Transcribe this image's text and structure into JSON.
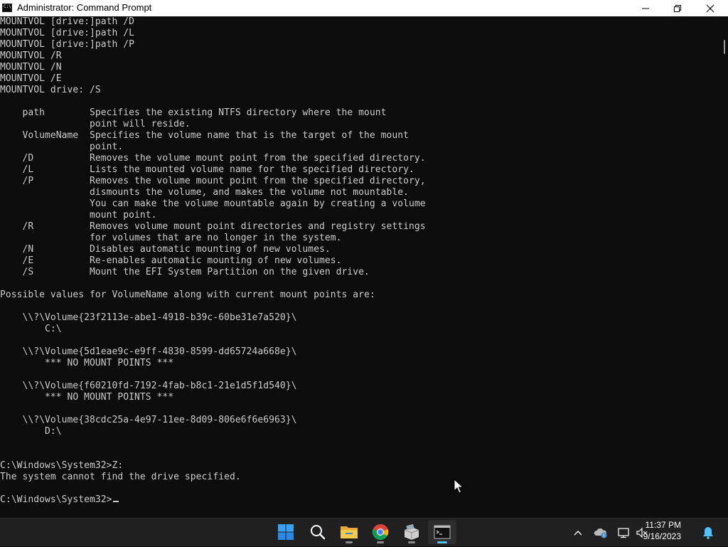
{
  "window": {
    "title": "Administrator: Command Prompt",
    "icon_text": "C:\\"
  },
  "console": {
    "lines": [
      "MOUNTVOL [drive:]path /D",
      "MOUNTVOL [drive:]path /L",
      "MOUNTVOL [drive:]path /P",
      "MOUNTVOL /R",
      "MOUNTVOL /N",
      "MOUNTVOL /E",
      "MOUNTVOL drive: /S",
      "",
      "    path        Specifies the existing NTFS directory where the mount",
      "                point will reside.",
      "    VolumeName  Specifies the volume name that is the target of the mount",
      "                point.",
      "    /D          Removes the volume mount point from the specified directory.",
      "    /L          Lists the mounted volume name for the specified directory.",
      "    /P          Removes the volume mount point from the specified directory,",
      "                dismounts the volume, and makes the volume not mountable.",
      "                You can make the volume mountable again by creating a volume",
      "                mount point.",
      "    /R          Removes volume mount point directories and registry settings",
      "                for volumes that are no longer in the system.",
      "    /N          Disables automatic mounting of new volumes.",
      "    /E          Re-enables automatic mounting of new volumes.",
      "    /S          Mount the EFI System Partition on the given drive.",
      "",
      "Possible values for VolumeName along with current mount points are:",
      "",
      "    \\\\?\\Volume{23f2113e-abe1-4918-b39c-60be31e7a520}\\",
      "        C:\\",
      "",
      "    \\\\?\\Volume{5d1eae9c-e9ff-4830-8599-dd65724a668e}\\",
      "        *** NO MOUNT POINTS ***",
      "",
      "    \\\\?\\Volume{f60210fd-7192-4fab-b8c1-21e1d5f1d540}\\",
      "        *** NO MOUNT POINTS ***",
      "",
      "    \\\\?\\Volume{38cdc25a-4e97-11ee-8d09-806e6f6e6963}\\",
      "        D:\\",
      "",
      "",
      "C:\\Windows\\System32>Z:",
      "The system cannot find the drive specified.",
      "",
      "C:\\Windows\\System32>"
    ]
  },
  "taskbar": {
    "apps": [
      {
        "name": "start-button",
        "icon": "windows-logo-icon"
      },
      {
        "name": "search-button",
        "icon": "search-icon"
      },
      {
        "name": "file-explorer-button",
        "icon": "folder-icon"
      },
      {
        "name": "chrome-button",
        "icon": "chrome-icon"
      },
      {
        "name": "installer-button",
        "icon": "package-icon"
      },
      {
        "name": "command-prompt-button",
        "icon": "terminal-icon"
      }
    ],
    "clock": {
      "time": "11:37 PM",
      "date": "9/16/2023"
    }
  },
  "colors": {
    "console_bg": "#0c0c0c",
    "console_fg": "#cccccc",
    "taskbar_bg": "#202020",
    "accent": "#4cc2ff"
  }
}
